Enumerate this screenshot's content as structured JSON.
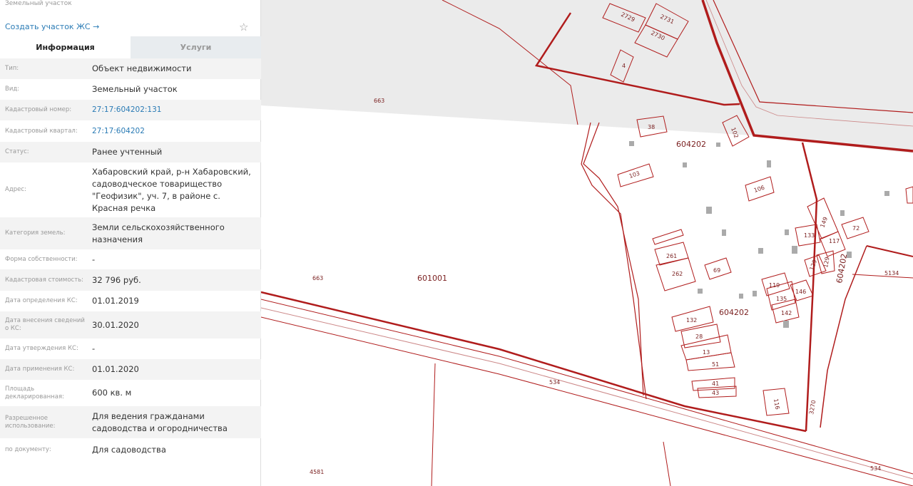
{
  "header": {
    "subtitle": "Земельный участок",
    "create_link": "Создать участок ЖС →",
    "star_icon": "star-icon"
  },
  "tabs": [
    {
      "label": "Информация",
      "active": true
    },
    {
      "label": "Услуги",
      "active": false
    }
  ],
  "rows": [
    {
      "label": "Тип:",
      "value": "Объект недвижимости"
    },
    {
      "label": "Вид:",
      "value": "Земельный участок"
    },
    {
      "label": "Кадастровый номер:",
      "value": "27:17:604202:131",
      "link": true
    },
    {
      "label": "Кадастровый квартал:",
      "value": "27:17:604202",
      "link": true
    },
    {
      "label": "Статус:",
      "value": "Ранее учтенный"
    },
    {
      "label": "Адрес:",
      "value": "Хабаровский край, р-н Хабаровский, садоводческое товарищество \"Геофизик\", уч. 7, в районе с. Красная речка"
    },
    {
      "label": "Категория земель:",
      "value": "Земли сельскохозяйственного назначения"
    },
    {
      "label": "Форма собственности:",
      "value": "-"
    },
    {
      "label": "Кадастровая стоимость:",
      "value": "32 796 руб."
    },
    {
      "label": "Дата определения КС:",
      "value": "01.01.2019"
    },
    {
      "label": "Дата внесения сведений о КС:",
      "value": "30.01.2020"
    },
    {
      "label": "Дата утверждения КС:",
      "value": "-"
    },
    {
      "label": "Дата применения КС:",
      "value": "01.01.2020"
    },
    {
      "label": "Площадь декларированная:",
      "value": "600 кв. м"
    },
    {
      "label": "Разрешенное использование:",
      "value": "Для ведения гражданами садоводства и огородничества"
    },
    {
      "label": "по документу:",
      "value": "Для садоводства"
    }
  ],
  "map": {
    "colors": {
      "boundary": "#b01c1c",
      "gray_area": "#ebebeb"
    },
    "labels": [
      "663",
      "663",
      "601001",
      "604202",
      "604202",
      "604202",
      "534",
      "534",
      "4581",
      "5134",
      "3270",
      "2729",
      "2731",
      "2730",
      "4",
      "38",
      "102",
      "103",
      "106",
      "133",
      "149",
      "117",
      "72",
      "261",
      "262",
      "69",
      "129",
      "129",
      "119",
      "135",
      "146",
      "142",
      "132",
      "28",
      "13",
      "51",
      "41",
      "43",
      "116"
    ]
  }
}
